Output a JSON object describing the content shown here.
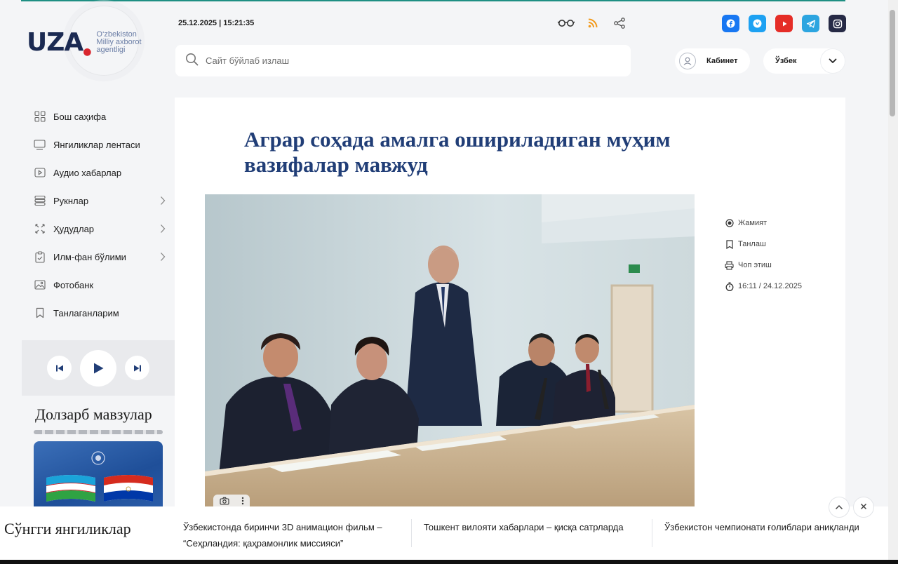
{
  "logo": {
    "word": "UZA",
    "subtitle_lines": [
      "O‘zbekiston",
      "Milliy axborot",
      "agentligi"
    ]
  },
  "header": {
    "datetime": "25.12.2025 | 15:21:35",
    "search_placeholder": "Сайт бўйлаб излаш",
    "cabinet_label": "Кабинет",
    "language": "Ўзбек",
    "tools": [
      "glasses-icon",
      "rss-icon",
      "share-icon"
    ],
    "socials": [
      {
        "name": "facebook-icon",
        "color": "#1877f2"
      },
      {
        "name": "vk-icon",
        "color": "#1da1f2"
      },
      {
        "name": "youtube-icon",
        "color": "#e52d27"
      },
      {
        "name": "telegram-icon",
        "color": "#2ca5e0"
      },
      {
        "name": "instagram-icon",
        "color": "#262a46"
      }
    ]
  },
  "sidebar": {
    "items": [
      {
        "label": "Бош саҳифа",
        "icon": "grid-icon",
        "has_submenu": false
      },
      {
        "label": "Янгиликлар лентаси",
        "icon": "monitor-icon",
        "has_submenu": false
      },
      {
        "label": "Аудио хабарлар",
        "icon": "play-box-icon",
        "has_submenu": false
      },
      {
        "label": "Рукнлар",
        "icon": "layers-icon",
        "has_submenu": true
      },
      {
        "label": "Ҳудудлар",
        "icon": "arrows-icon",
        "has_submenu": true
      },
      {
        "label": "Илм-фан бўлими",
        "icon": "clipboard-icon",
        "has_submenu": true
      },
      {
        "label": "Фотобанк",
        "icon": "image-icon",
        "has_submenu": false
      },
      {
        "label": "Танлаганларим",
        "icon": "bookmark-icon",
        "has_submenu": false
      }
    ],
    "topics_title": "Долзарб мавзулар"
  },
  "article": {
    "title": "Аграр соҳада амалга ошириладиган муҳим вазифалар мавжуд",
    "meta": {
      "category": "Жамият",
      "select_label": "Танлаш",
      "print_label": "Чоп этиш",
      "published": "16:11 / 24.12.2025"
    }
  },
  "ticker": {
    "title": "Сўнгги янгиликлар",
    "items": [
      "Ўзбекистонда биринчи 3D анимацион фильм – “Сеҳрландия: қаҳрамонлик миссияси”",
      "Тошкент вилояти хабарлари – қисқа сатрларда",
      "Ўзбекистон чемпионати ғолиблари аниқланди"
    ]
  },
  "colors": {
    "accent": "#1e8f83",
    "title_blue": "#213e77",
    "brand_navy": "#1b2a52",
    "brand_red": "#d9262e"
  }
}
